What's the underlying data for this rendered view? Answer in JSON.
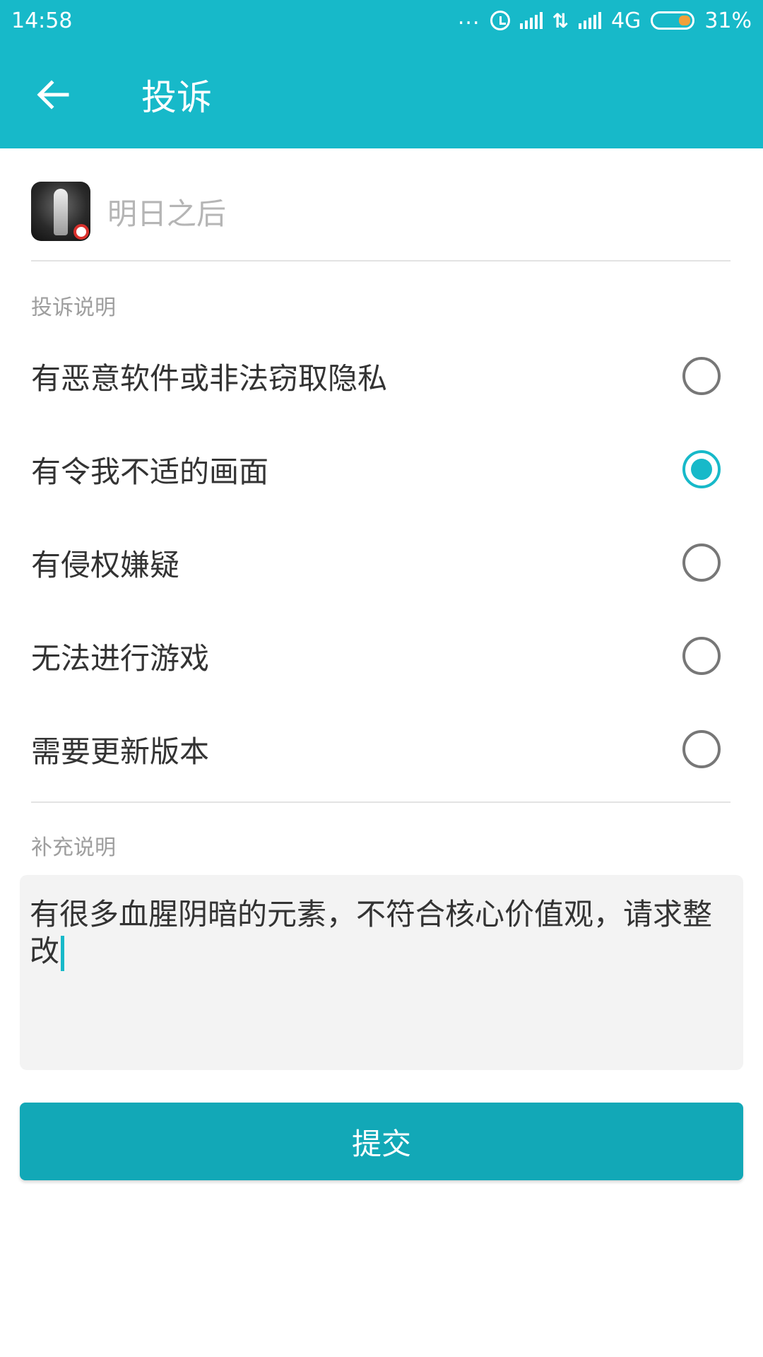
{
  "status_bar": {
    "time": "14:58",
    "dots": "...",
    "network_type": "4G",
    "battery_percent": "31%",
    "battery_level": 0.31
  },
  "header": {
    "title": "投诉",
    "back_icon": "arrow-left-icon"
  },
  "app": {
    "name": "明日之后"
  },
  "complaint_section": {
    "label": "投诉说明",
    "options": [
      {
        "label": "有恶意软件或非法窃取隐私",
        "checked": false
      },
      {
        "label": "有令我不适的画面",
        "checked": true
      },
      {
        "label": "有侵权嫌疑",
        "checked": false
      },
      {
        "label": "无法进行游戏",
        "checked": false
      },
      {
        "label": "需要更新版本",
        "checked": false
      }
    ]
  },
  "supplement_section": {
    "label": "补充说明",
    "text": "有很多血腥阴暗的元素，不符合核心价值观，请求整改"
  },
  "submit_label": "提交",
  "colors": {
    "accent": "#17b9c9",
    "button": "#12a8b7",
    "battery": "#f2a03a"
  }
}
